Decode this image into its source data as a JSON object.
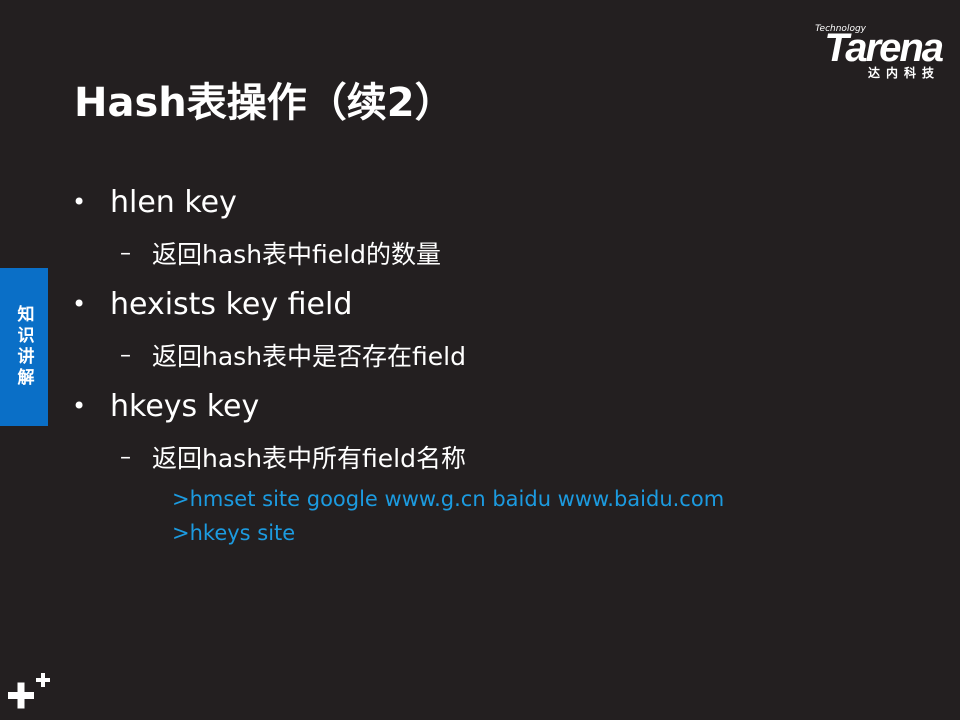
{
  "slide": {
    "title": "Hash表操作（续2）",
    "side_tab": "知识讲解"
  },
  "logo": {
    "tagline": "Technology",
    "word": "Tarena",
    "cn": "达内科技"
  },
  "bullets": [
    {
      "dot": "•",
      "text": "hlen key",
      "sub_dash": "–",
      "sub": "返回hash表中field的数量"
    },
    {
      "dot": "•",
      "text": "hexists key field",
      "sub_dash": "–",
      "sub": "返回hash表中是否存在field"
    },
    {
      "dot": "•",
      "text": "hkeys key",
      "sub_dash": "–",
      "sub": "返回hash表中所有field名称"
    }
  ],
  "code_lines": [
    ">hmset site google www.g.cn baidu www.baidu.com",
    ">hkeys site"
  ],
  "colors": {
    "background": "#231f20",
    "side_tab": "#0a6fc7",
    "code": "#1c9be0"
  },
  "icons": {
    "bottom_left": "plus-plus-icon"
  }
}
